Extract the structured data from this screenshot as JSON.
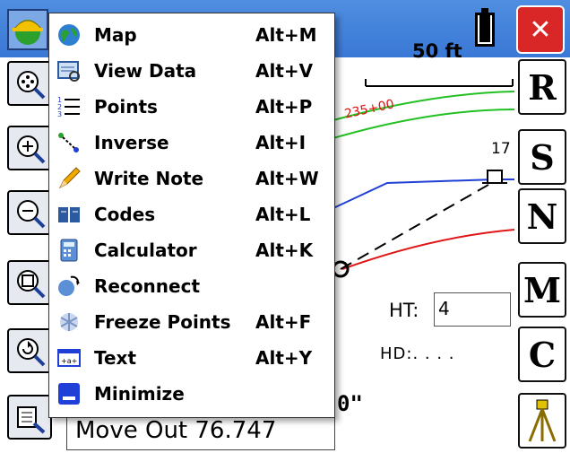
{
  "titlebar": {
    "app_icon": "carlson-hardhat-icon",
    "battery_icon": "battery-icon",
    "close_label": "✕"
  },
  "left_toolbar": [
    {
      "name": "zoom-extents-icon"
    },
    {
      "name": "zoom-in-icon"
    },
    {
      "name": "zoom-out-icon"
    },
    {
      "name": "zoom-window-icon"
    },
    {
      "name": "zoom-previous-icon"
    },
    {
      "name": "detail-view-icon"
    }
  ],
  "right_buttons": [
    {
      "label": "R"
    },
    {
      "label": "S"
    },
    {
      "label": "N"
    },
    {
      "label": "M"
    },
    {
      "label": "C"
    },
    {
      "label": "",
      "icon": "tripod-icon"
    }
  ],
  "map": {
    "scale_label": "50 ft",
    "station_label": "235+00",
    "point_number": "17",
    "colors": {
      "green": "#22c022",
      "blue": "#1f3fd6",
      "red": "#e01515",
      "dashed": "#000000"
    }
  },
  "fields": {
    "ht_label": "HT:",
    "ht_value": "4",
    "hd_label": "HD:. . . .",
    "partial_text": "0\""
  },
  "status_text": "Move Out 76.747",
  "menu": {
    "items": [
      {
        "label": "Map",
        "shortcut": "Alt+M",
        "icon": "globe-icon"
      },
      {
        "label": "View Data",
        "shortcut": "Alt+V",
        "icon": "view-data-icon"
      },
      {
        "label": "Points",
        "shortcut": "Alt+P",
        "icon": "numbered-list-icon"
      },
      {
        "label": "Inverse",
        "shortcut": "Alt+I",
        "icon": "inverse-icon"
      },
      {
        "label": "Write Note",
        "shortcut": "Alt+W",
        "icon": "pencil-icon"
      },
      {
        "label": "Codes",
        "shortcut": "Alt+L",
        "icon": "book-icon"
      },
      {
        "label": "Calculator",
        "shortcut": "Alt+K",
        "icon": "calculator-icon"
      },
      {
        "label": "Reconnect",
        "shortcut": "",
        "icon": "reconnect-icon"
      },
      {
        "label": "Freeze Points",
        "shortcut": "Alt+F",
        "icon": "freeze-icon"
      },
      {
        "label": "Text",
        "shortcut": "Alt+Y",
        "icon": "text-field-icon"
      },
      {
        "label": "Minimize",
        "shortcut": "",
        "icon": "minimize-icon"
      }
    ]
  }
}
